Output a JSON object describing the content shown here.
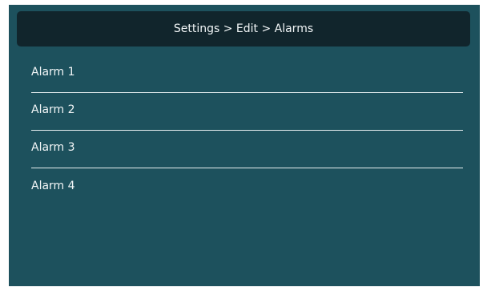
{
  "header": {
    "breadcrumb": "Settings > Edit > Alarms"
  },
  "alarms": [
    {
      "label": "Alarm 1"
    },
    {
      "label": "Alarm 2"
    },
    {
      "label": "Alarm 3"
    },
    {
      "label": "Alarm 4"
    }
  ],
  "colors": {
    "panel_background": "#1d515d",
    "header_background": "#11252c",
    "text": "#f2f6f7",
    "divider": "#e6eef0"
  }
}
